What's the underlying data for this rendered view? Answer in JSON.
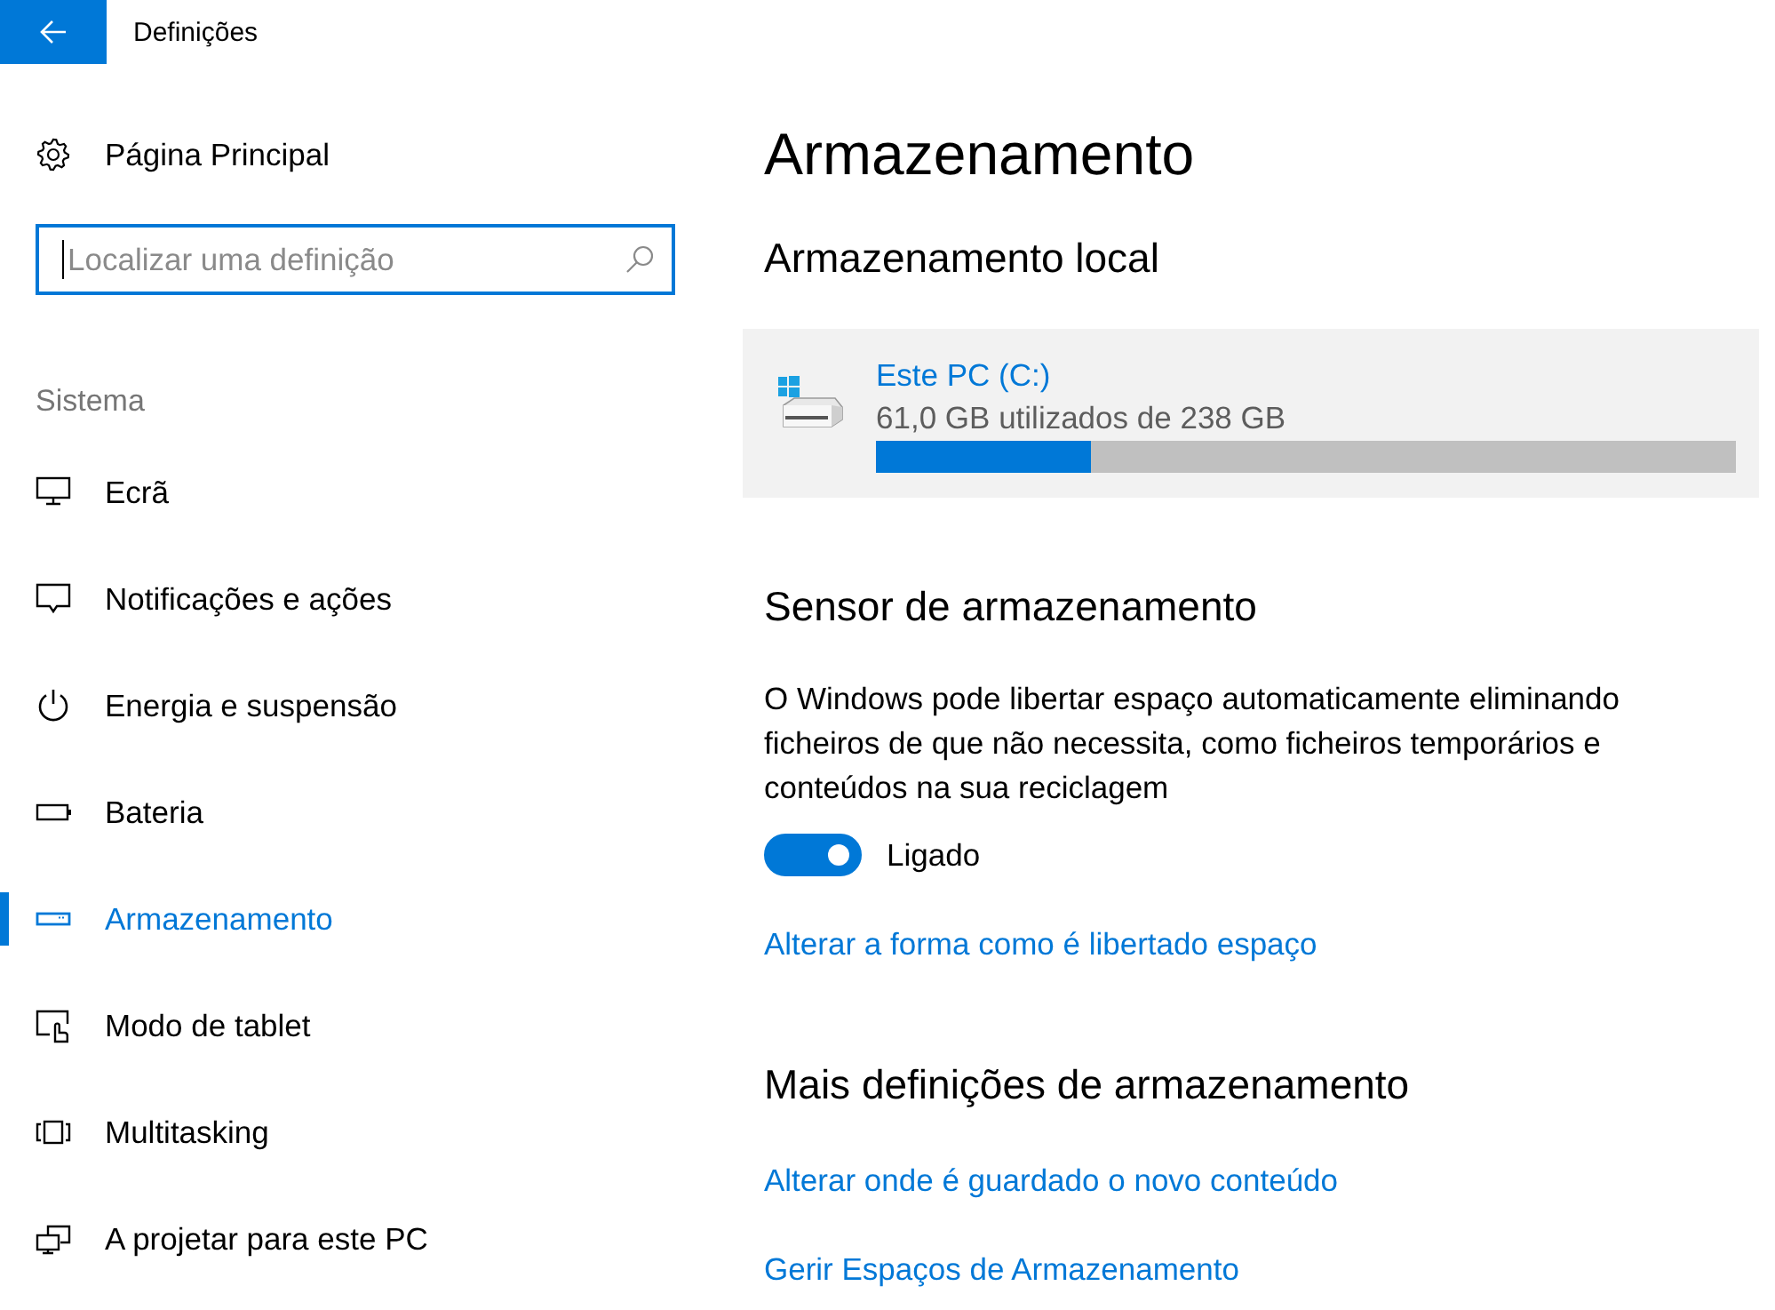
{
  "window": {
    "title": "Definições"
  },
  "sidebar": {
    "home": {
      "label": "Página Principal"
    },
    "search": {
      "placeholder": "Localizar uma definição",
      "focused": true
    },
    "section": "Sistema",
    "items": [
      {
        "label": "Ecrã",
        "selected": false
      },
      {
        "label": "Notificações e ações",
        "selected": false
      },
      {
        "label": "Energia e suspensão",
        "selected": false
      },
      {
        "label": "Bateria",
        "selected": false
      },
      {
        "label": "Armazenamento",
        "selected": true
      },
      {
        "label": "Modo de tablet",
        "selected": false
      },
      {
        "label": "Multitasking",
        "selected": false
      },
      {
        "label": "A projetar para este PC",
        "selected": false
      }
    ]
  },
  "main": {
    "title": "Armazenamento",
    "local_storage": {
      "heading": "Armazenamento local",
      "drives": [
        {
          "name": "Este PC (C:)",
          "usage": "61,0 GB utilizados de 238 GB",
          "level": 0.25
        }
      ]
    },
    "storage_sense": {
      "heading": "Sensor de armazenamento",
      "description": "O Windows pode libertar espaço automaticamente eliminando ficheiros de que não necessita, como ficheiros temporários e conteúdos na sua reciclagem",
      "toggle": {
        "on": true,
        "label": "Ligado"
      },
      "link": "Alterar a forma como é libertado espaço"
    },
    "more_settings": {
      "heading": "Mais definições de armazenamento",
      "links": [
        "Alterar onde é guardado o novo conteúdo",
        "Gerir Espaços de Armazenamento"
      ]
    }
  }
}
